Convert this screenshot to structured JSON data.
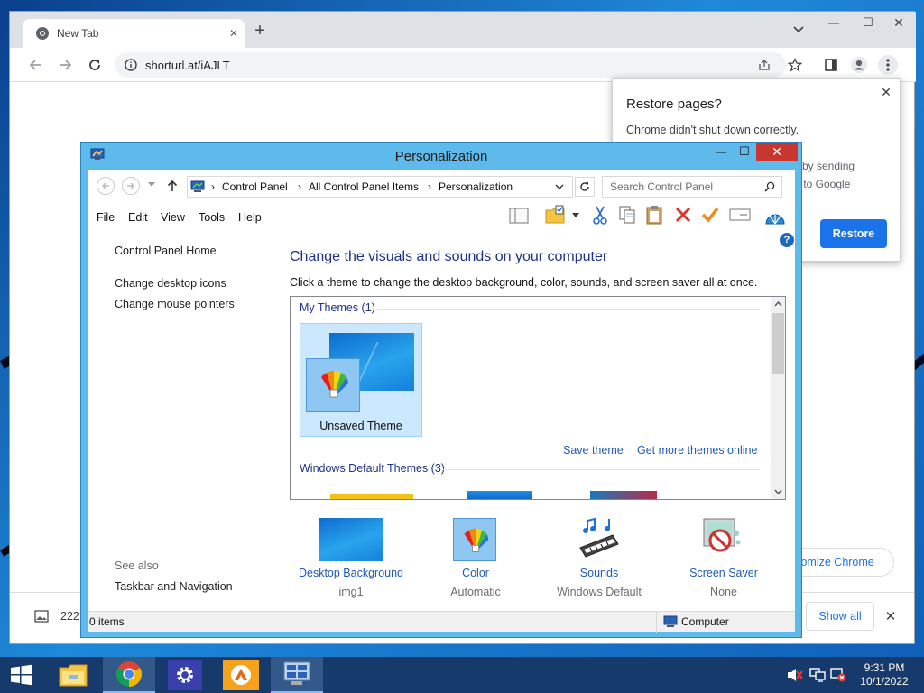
{
  "browser": {
    "tab_title": "New Tab",
    "url": "shorturl.at/iAJLT",
    "new_tab_symbol": "+",
    "minimize_symbol": "—",
    "maximize_symbol": "☐",
    "close_symbol": "✕"
  },
  "restore_popup": {
    "title": "Restore pages?",
    "message": "Chrome didn't shut down correctly.",
    "fragment_1": "er by sending",
    "fragment_2": "cs to Google",
    "button": "Restore"
  },
  "customize_chip": "tomize Chrome",
  "download_bar": {
    "filename": "222",
    "show_all": "Show all"
  },
  "personalization": {
    "title": "Personalization",
    "breadcrumb": [
      "Control Panel",
      "All Control Panel Items",
      "Personalization"
    ],
    "search_placeholder": "Search Control Panel",
    "menu": [
      "File",
      "Edit",
      "View",
      "Tools",
      "Help"
    ],
    "sidebar": {
      "home": "Control Panel Home",
      "links": [
        "Change desktop icons",
        "Change mouse pointers"
      ],
      "see_also": "See also",
      "see_also_links": [
        "Taskbar and Navigation"
      ]
    },
    "heading": "Change the visuals and sounds on your computer",
    "subheading": "Click a theme to change the desktop background, color, sounds, and screen saver all at once.",
    "my_themes": "My Themes (1)",
    "unsaved_theme": "Unsaved Theme",
    "save_theme": "Save theme",
    "get_more": "Get more themes online",
    "default_themes": "Windows Default Themes (3)",
    "bottom_items": [
      {
        "label": "Desktop Background",
        "value": "img1"
      },
      {
        "label": "Color",
        "value": "Automatic"
      },
      {
        "label": "Sounds",
        "value": "Windows Default"
      },
      {
        "label": "Screen Saver",
        "value": "None"
      }
    ],
    "status_items": "0 items",
    "status_location": "Computer",
    "help_symbol": "?"
  },
  "taskbar": {
    "time": "9:31 PM",
    "date": "10/1/2022"
  },
  "colors": {
    "accent": "#1a73e8",
    "window_frame": "#5ebaeb",
    "link": "#1e5ab8",
    "heading": "#1e3287"
  }
}
